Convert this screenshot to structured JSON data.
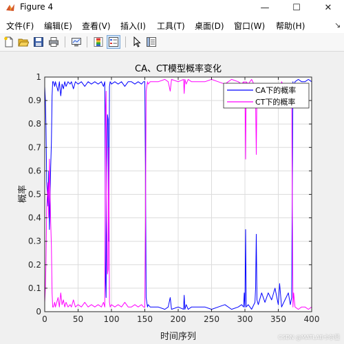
{
  "window": {
    "title": "Figure 4",
    "minimize_glyph": "—",
    "maximize_glyph": "☐",
    "close_glyph": "✕",
    "icon": "matlab-icon"
  },
  "menu": {
    "items": [
      "文件(F)",
      "编辑(E)",
      "查看(V)",
      "插入(I)",
      "工具(T)",
      "桌面(D)",
      "窗口(W)",
      "帮助(H)"
    ],
    "overflow_glyph": "↘"
  },
  "toolbar": {
    "icons": [
      "new-figure-icon",
      "open-file-icon",
      "save-icon",
      "print-icon",
      "link-plot-icon",
      "insert-colorbar-icon",
      "insert-legend-icon",
      "edit-plot-icon",
      "property-inspector-icon"
    ]
  },
  "watermark": "CSDN @MATLAB卡尔曼",
  "chart_data": {
    "type": "line",
    "title": "CA、CT模型概率变化",
    "xlabel": "时间序列",
    "ylabel": "概率",
    "xlim": [
      0,
      400
    ],
    "ylim": [
      0,
      1
    ],
    "xticks": [
      0,
      50,
      100,
      150,
      200,
      250,
      300,
      350,
      400
    ],
    "yticks": [
      0,
      0.1,
      0.2,
      0.3,
      0.4,
      0.5,
      0.6,
      0.7,
      0.8,
      0.9,
      1
    ],
    "grid": true,
    "legend_position": "top-right",
    "series": [
      {
        "name": "CA下的概率",
        "color": "#0000ff",
        "x": [
          0,
          1,
          2,
          3,
          4,
          5,
          6,
          7,
          8,
          9,
          10,
          11,
          12,
          13,
          14,
          15,
          16,
          18,
          20,
          22,
          24,
          26,
          28,
          30,
          32,
          35,
          38,
          40,
          43,
          46,
          50,
          55,
          60,
          65,
          70,
          75,
          80,
          85,
          88,
          90,
          91,
          92,
          93,
          94,
          95,
          96,
          97,
          98,
          100,
          105,
          110,
          115,
          120,
          125,
          130,
          135,
          140,
          145,
          148,
          150,
          151,
          152,
          153,
          154,
          155,
          158,
          160,
          170,
          180,
          185,
          188,
          190,
          200,
          208,
          209,
          210,
          212,
          215,
          220,
          230,
          240,
          250,
          260,
          270,
          280,
          290,
          295,
          298,
          299,
          300,
          301,
          302,
          305,
          310,
          315,
          316,
          317,
          318,
          320,
          325,
          330,
          335,
          340,
          345,
          350,
          352,
          355,
          360,
          365,
          368,
          370,
          372,
          373,
          375,
          380,
          385,
          390,
          395,
          400
        ],
        "values": [
          0.96,
          0.9,
          0.78,
          0.55,
          0.5,
          0.45,
          0.6,
          0.35,
          0.5,
          0.62,
          0.72,
          0.92,
          0.98,
          0.98,
          0.97,
          0.96,
          0.98,
          0.96,
          0.94,
          0.98,
          0.92,
          0.97,
          0.95,
          0.98,
          0.96,
          0.98,
          0.97,
          0.98,
          0.95,
          0.98,
          0.97,
          0.98,
          0.96,
          0.98,
          0.97,
          0.98,
          0.97,
          0.98,
          0.96,
          0.98,
          0.15,
          0.06,
          0.6,
          0.84,
          0.82,
          0.3,
          0.96,
          0.98,
          0.97,
          0.98,
          0.97,
          0.98,
          0.96,
          0.98,
          0.98,
          0.97,
          0.98,
          0.97,
          0.98,
          0.98,
          0.62,
          0.06,
          0.04,
          0.02,
          0.03,
          0.02,
          0.02,
          0.02,
          0.01,
          0.02,
          0.06,
          0.01,
          0.02,
          0.01,
          0.07,
          0.01,
          0.03,
          0.01,
          0.02,
          0.02,
          0.02,
          0.01,
          0.02,
          0.03,
          0.01,
          0.02,
          0.03,
          0.02,
          0.08,
          0.02,
          0.35,
          0.02,
          0.03,
          0.01,
          0.04,
          0.1,
          0.33,
          0.05,
          0.03,
          0.08,
          0.04,
          0.08,
          0.05,
          0.1,
          0.03,
          0.12,
          0.02,
          0.05,
          0.08,
          0.03,
          0.06,
          0.98,
          0.92,
          0.98,
          0.99,
          0.98,
          0.98,
          0.99,
          0.98
        ]
      },
      {
        "name": "CT下的概率",
        "color": "#ff00ff",
        "x": [
          0,
          1,
          2,
          3,
          4,
          5,
          6,
          7,
          8,
          9,
          10,
          11,
          12,
          13,
          14,
          15,
          16,
          18,
          20,
          22,
          24,
          26,
          28,
          30,
          32,
          35,
          38,
          40,
          43,
          46,
          50,
          55,
          60,
          65,
          70,
          75,
          80,
          85,
          88,
          90,
          91,
          92,
          93,
          94,
          95,
          96,
          97,
          98,
          100,
          105,
          110,
          115,
          120,
          125,
          130,
          135,
          140,
          145,
          148,
          150,
          151,
          152,
          153,
          154,
          155,
          158,
          160,
          170,
          180,
          185,
          188,
          190,
          200,
          208,
          209,
          210,
          212,
          215,
          220,
          230,
          240,
          250,
          260,
          270,
          280,
          290,
          295,
          298,
          299,
          300,
          301,
          302,
          305,
          310,
          315,
          316,
          317,
          318,
          320,
          325,
          330,
          335,
          340,
          345,
          350,
          352,
          355,
          360,
          365,
          368,
          370,
          372,
          373,
          375,
          380,
          385,
          390,
          395,
          400
        ],
        "values": [
          0.04,
          0.1,
          0.22,
          0.45,
          0.5,
          0.55,
          0.4,
          0.65,
          0.5,
          0.38,
          0.28,
          0.08,
          0.02,
          0.02,
          0.03,
          0.04,
          0.02,
          0.04,
          0.06,
          0.02,
          0.08,
          0.03,
          0.05,
          0.02,
          0.04,
          0.02,
          0.03,
          0.02,
          0.05,
          0.02,
          0.03,
          0.02,
          0.04,
          0.02,
          0.03,
          0.02,
          0.03,
          0.02,
          0.04,
          0.02,
          0.85,
          0.94,
          0.4,
          0.16,
          0.18,
          0.7,
          0.04,
          0.02,
          0.03,
          0.02,
          0.03,
          0.02,
          0.04,
          0.02,
          0.02,
          0.03,
          0.02,
          0.03,
          0.02,
          0.02,
          0.38,
          0.94,
          0.96,
          0.98,
          0.97,
          0.98,
          0.98,
          0.98,
          0.99,
          0.98,
          0.94,
          0.99,
          0.98,
          0.99,
          0.93,
          0.99,
          0.97,
          0.99,
          0.98,
          0.98,
          0.98,
          0.99,
          0.98,
          0.97,
          0.99,
          0.98,
          0.97,
          0.98,
          0.92,
          0.98,
          0.65,
          0.98,
          0.97,
          0.99,
          0.96,
          0.9,
          0.67,
          0.95,
          0.97,
          0.92,
          0.96,
          0.92,
          0.95,
          0.9,
          0.97,
          0.88,
          0.98,
          0.95,
          0.92,
          0.97,
          0.94,
          0.02,
          0.08,
          0.02,
          0.01,
          0.02,
          0.02,
          0.01,
          0.02
        ]
      }
    ]
  }
}
